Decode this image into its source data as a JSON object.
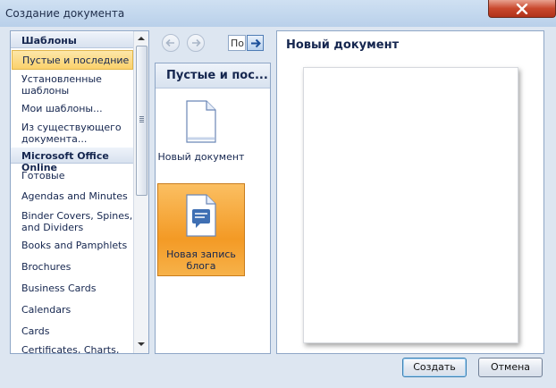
{
  "window": {
    "title": "Создание документа"
  },
  "left": {
    "section_templates": "Шаблоны",
    "items": [
      "Пустые и последние",
      "Установленные шаблоны",
      "Мои шаблоны...",
      "Из существующего документа..."
    ],
    "section_online": "Microsoft Office Online",
    "online_items": [
      "Готовые",
      "Agendas and Minutes",
      "Binder Covers, Spines, and Dividers",
      "Books and Pamphlets",
      "Brochures",
      "Business Cards",
      "Calendars",
      "Cards",
      "Certificates, Charts,"
    ]
  },
  "middle": {
    "search_value": "Поиск",
    "header": "Пустые и пос...",
    "templates": [
      {
        "label": "Новый документ",
        "icon": "blank-document-icon"
      },
      {
        "label": "Новая запись блога",
        "icon": "blog-post-icon"
      }
    ]
  },
  "right": {
    "title": "Новый документ"
  },
  "buttons": {
    "create": "Создать",
    "cancel": "Отмена"
  },
  "colors": {
    "selection": "#fbd16b",
    "template_selected": "#f39a25",
    "close": "#c9482d"
  }
}
